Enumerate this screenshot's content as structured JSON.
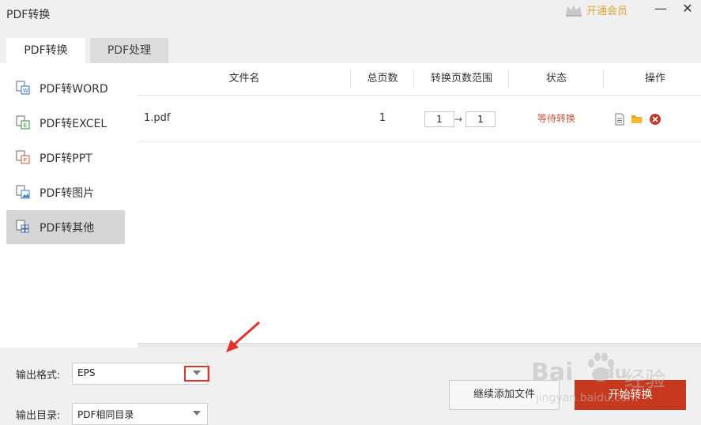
{
  "app": {
    "title": "PDF转换"
  },
  "header": {
    "vip_label": "开通会员",
    "minimize_glyph": "—",
    "close_glyph": "✕"
  },
  "tabs": [
    {
      "label": "PDF转换",
      "active": true
    },
    {
      "label": "PDF处理",
      "active": false
    }
  ],
  "sidebar": {
    "items": [
      {
        "label": "PDF转WORD",
        "icon": "word-icon",
        "active": false
      },
      {
        "label": "PDF转EXCEL",
        "icon": "excel-icon",
        "active": false
      },
      {
        "label": "PDF转PPT",
        "icon": "ppt-icon",
        "active": false
      },
      {
        "label": "PDF转图片",
        "icon": "image-icon",
        "active": false
      },
      {
        "label": "PDF转其他",
        "icon": "other-format-icon",
        "active": true
      }
    ]
  },
  "table": {
    "columns": [
      "文件名",
      "总页数",
      "转换页数范围",
      "状态",
      "操作"
    ],
    "rows": [
      {
        "filename": "1.pdf",
        "pages": "1",
        "range_from": "1",
        "range_to": "1",
        "status": "等待转换",
        "actions": [
          "document-icon",
          "folder-icon",
          "delete-icon"
        ]
      }
    ]
  },
  "bottom": {
    "format_label": "输出格式:",
    "format_value": "EPS",
    "dir_label": "输出目录:",
    "dir_value": "PDF相同目录",
    "add_button": "继续添加文件",
    "start_button": "开始转换"
  },
  "colors": {
    "accent": "#c6391f",
    "status": "#c9573a",
    "vip": "#e2a23a",
    "highlight": "#e0332b"
  },
  "watermark": {
    "brand": "Bai",
    "brand2": "du",
    "text": "经验",
    "url": "jingyan.baidu.com"
  }
}
